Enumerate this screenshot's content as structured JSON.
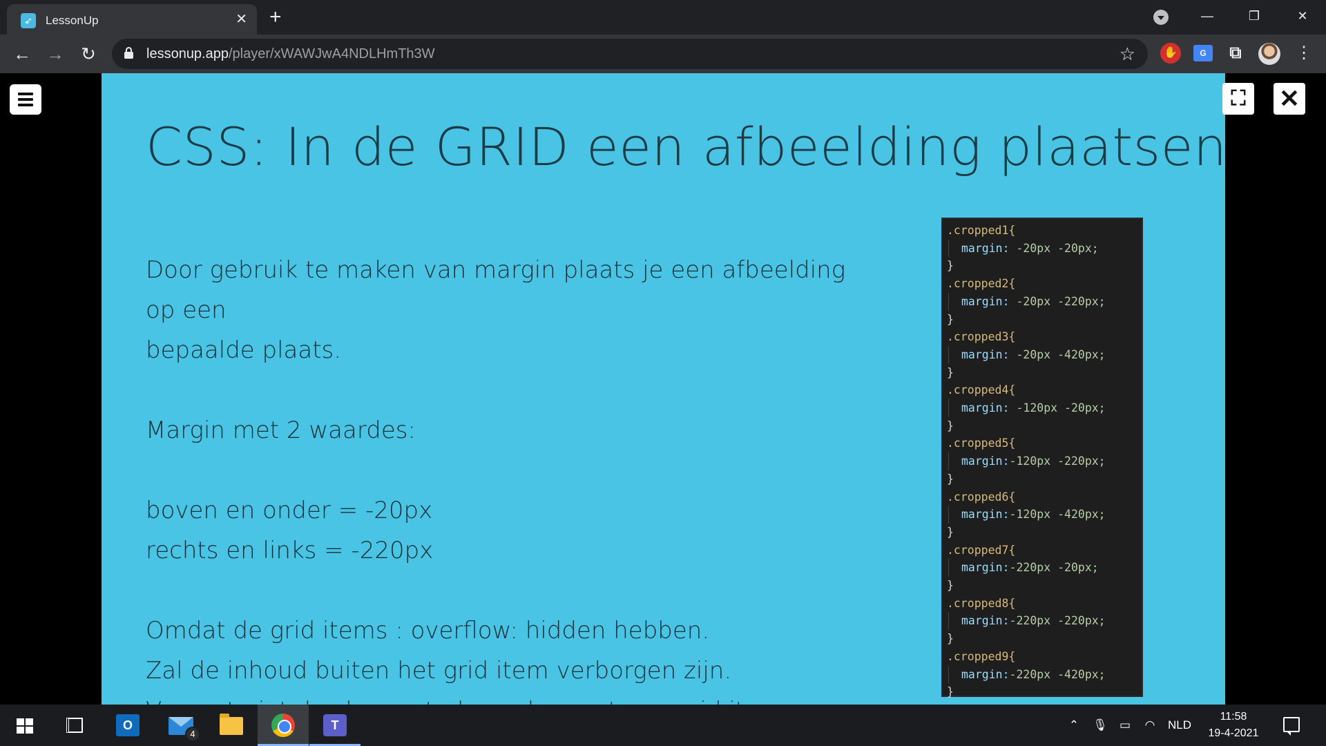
{
  "browser": {
    "tab_title": "LessonUp",
    "url_domain": "lessonup.app",
    "url_path": "/player/xWAWJwA4NDLHmTh3W"
  },
  "slide": {
    "title": "CSS: In de GRID een afbeelding plaatsen.",
    "paragraphs": [
      "Door gebruik te maken van margin plaats je een afbeelding op een",
      "bepaalde plaats.",
      "",
      "Margin met 2 waardes:",
      "",
      "boven en onder = -20px",
      "rechts en links = -220px",
      "",
      "Omdat de grid items : overflow: hidden hebben.",
      "Zal de inhoud buiten het grid item verborgen zijn.",
      "Vergeet niet de classes te koppelen met een grid item."
    ],
    "code_rules": [
      {
        "selector": ".cropped1{",
        "property": "margin:",
        "value": " -20px -20px;",
        "close": "}"
      },
      {
        "selector": ".cropped2{",
        "property": "margin:",
        "value": " -20px -220px;",
        "close": "}"
      },
      {
        "selector": ".cropped3{",
        "property": "margin:",
        "value": " -20px -420px;",
        "close": "}"
      },
      {
        "selector": ".cropped4{",
        "property": "margin:",
        "value": " -120px -20px;",
        "close": "}"
      },
      {
        "selector": ".cropped5{",
        "property": "margin:",
        "value": "-120px -220px;",
        "close": "}"
      },
      {
        "selector": ".cropped6{",
        "property": "margin:",
        "value": "-120px -420px;",
        "close": "}"
      },
      {
        "selector": ".cropped7{",
        "property": "margin:",
        "value": "-220px -20px;",
        "close": "}"
      },
      {
        "selector": ".cropped8{",
        "property": "margin:",
        "value": "-220px -220px;",
        "close": "}"
      },
      {
        "selector": ".cropped9{",
        "property": "margin:",
        "value": "-220px -420px;",
        "close": "}"
      }
    ]
  },
  "taskbar": {
    "mail_badge": "4",
    "language": "NLD",
    "time": "11:58",
    "date": "19-4-2021"
  },
  "colors": {
    "slide_background": "#4ac4e4",
    "title_text": "#1d3b45",
    "code_background": "#1e1e1e"
  }
}
